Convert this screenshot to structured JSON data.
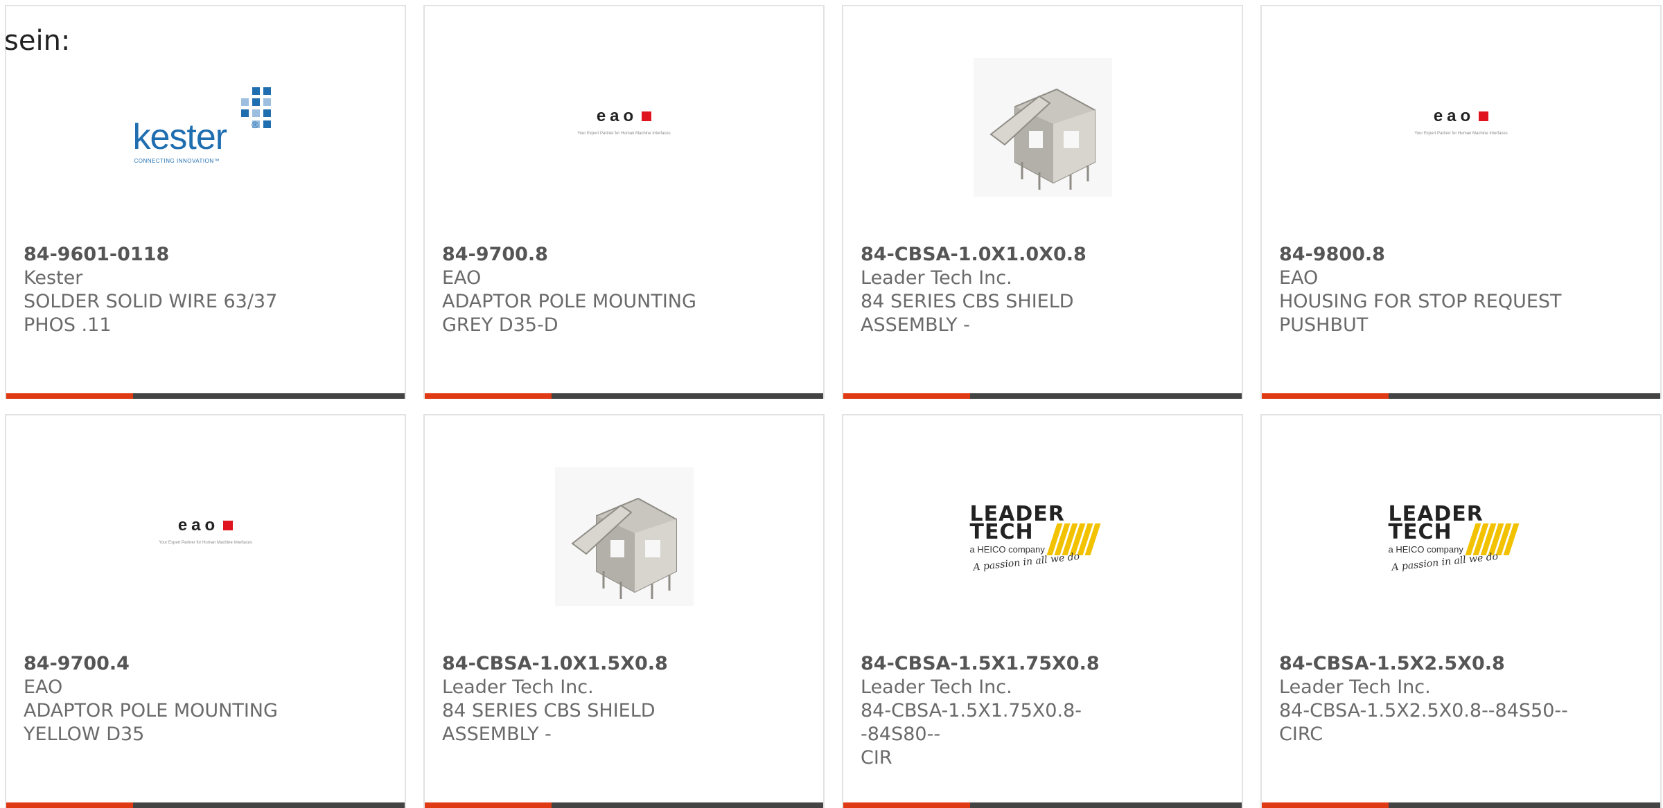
{
  "page_label": "sein:",
  "products": [
    {
      "part": "84-9601-0118",
      "maker": "Kester",
      "desc1": "SOLDER SOLID WIRE 63/37",
      "desc2": "PHOS .11",
      "image": "kester-logo"
    },
    {
      "part": "84-9700.8",
      "maker": "EAO",
      "desc1": "ADAPTOR POLE MOUNTING",
      "desc2": "GREY D35-D",
      "image": "eao-logo"
    },
    {
      "part": "84-CBSA-1.0X1.0X0.8",
      "maker": "Leader Tech Inc.",
      "desc1": "84 SERIES CBS SHIELD",
      "desc2": "ASSEMBLY -",
      "image": "shield-photo"
    },
    {
      "part": "84-9800.8",
      "maker": "EAO",
      "desc1": "HOUSING FOR STOP REQUEST",
      "desc2": "PUSHBUT",
      "image": "eao-logo"
    },
    {
      "part": "84-9700.4",
      "maker": "EAO",
      "desc1": "ADAPTOR POLE MOUNTING",
      "desc2": "YELLOW D35",
      "image": "eao-logo"
    },
    {
      "part": "84-CBSA-1.0X1.5X0.8",
      "maker": "Leader Tech Inc.",
      "desc1": "84 SERIES CBS SHIELD",
      "desc2": "ASSEMBLY -",
      "image": "shield-photo"
    },
    {
      "part": "84-CBSA-1.5X1.75X0.8",
      "maker": "Leader Tech Inc.",
      "desc1": "84-CBSA-1.5X1.75X0.8--84S80--",
      "desc2": "CIR",
      "image": "leader-tech-logo"
    },
    {
      "part": "84-CBSA-1.5X2.5X0.8",
      "maker": "Leader Tech Inc.",
      "desc1": "84-CBSA-1.5X2.5X0.8--84S50--",
      "desc2": "CIRC",
      "image": "leader-tech-logo"
    }
  ],
  "logos": {
    "kester": {
      "word": "kester",
      "reg": "®",
      "tag": "CONNECTING INNOVATION™"
    },
    "eao": {
      "name": "eao",
      "tag": "Your Expert Partner for Human Machine Interfaces"
    },
    "leader": {
      "line1": "LEADER",
      "line2": "TECH",
      "heico": "a HEICO company",
      "slogan": "A passion in all we do"
    }
  },
  "colors": {
    "accent_bar": "#e03a14",
    "dark_bar": "#444444",
    "card_border": "#e2e2e2",
    "text_grey": "#6a6a6a",
    "kester_blue": "#1f6eb0",
    "eao_red": "#e0141e",
    "leader_yellow": "#f2c200"
  }
}
